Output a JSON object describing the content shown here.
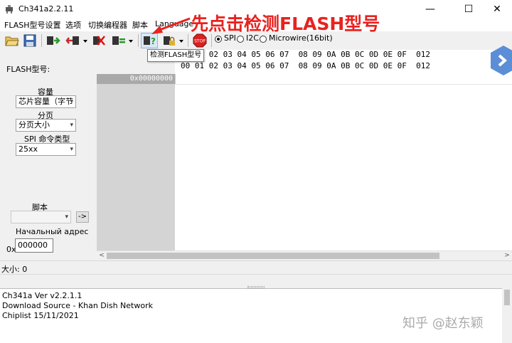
{
  "window": {
    "title": "Ch341a2.2.11",
    "controls": {
      "minimize": "—",
      "maximize": "☐",
      "close": "✕"
    }
  },
  "menu": [
    "FLASH型号设置",
    "选项",
    "切换编程器",
    "脚本",
    "Language"
  ],
  "toolbar": {
    "icons": [
      "open-icon",
      "save-icon",
      "read-icon",
      "write-icon",
      "erase-icon",
      "verify-icon",
      "detect-flash-icon",
      "lock-icon",
      "stop-icon"
    ],
    "stop_label": "STOP",
    "detect_glyph": "?",
    "interfaces": [
      "SPI",
      "I2C",
      "Microwire(16bit)"
    ],
    "selected_interface": "SPI"
  },
  "annotation": "先点击检测FLASH型号",
  "tooltip": "检测FLASH型号",
  "left_panel": {
    "flash_model_label": "FLASH型号:",
    "capacity_label": "容量",
    "capacity_value": "芯片容量（字节",
    "page_label": "分页",
    "page_value": "分页大小",
    "spi_cmd_label": "SPI 命令类型",
    "spi_cmd_value": "25xx",
    "script_label": "脚本",
    "script_value": "",
    "script_go": "->",
    "start_addr_label": "Начальный адрес",
    "addr_prefix": "0x",
    "addr_value": "000000"
  },
  "hex": {
    "header_row1": "00 01 02 03 04 05 06 07  08 09 0A 0B 0C 0D 0E 0F  012",
    "header_row2": "00 01 02 03 04 05 06 07  08 09 0A 0B 0C 0D 0E 0F  012",
    "first_address": "0x00000000"
  },
  "scroll": {
    "left": "<",
    "right": ">"
  },
  "status": {
    "size_text": "大小: 0"
  },
  "log": {
    "lines": [
      "Ch341a Ver v2.2.1.1",
      "Download Source - Khan Dish Network",
      "Chiplist 15/11/2021"
    ]
  },
  "watermark": "知乎 @赵东颖",
  "colors": {
    "annotation": "#e8221f",
    "address_cell": "#a9a9a9",
    "logo": "#5b8ed6"
  }
}
